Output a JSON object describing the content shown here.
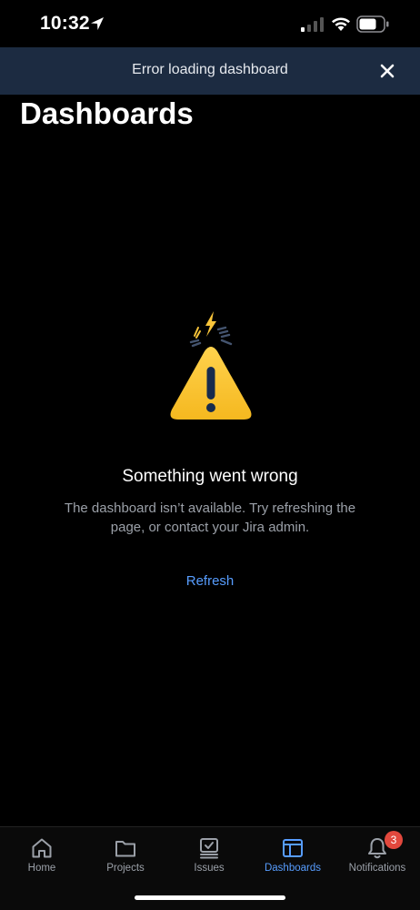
{
  "status_bar": {
    "time": "10:32"
  },
  "banner": {
    "message": "Error loading dashboard",
    "close_icon": "close-icon"
  },
  "header": {
    "title": "Dashboards"
  },
  "error_state": {
    "illustration": "warning-illustration",
    "title": "Something went wrong",
    "description": "The dashboard isn’t available. Try refreshing the page, or contact your Jira admin.",
    "action_label": "Refresh"
  },
  "tab_bar": {
    "tabs": [
      {
        "label": "Home",
        "icon": "home-icon",
        "active": false
      },
      {
        "label": "Projects",
        "icon": "folder-icon",
        "active": false
      },
      {
        "label": "Issues",
        "icon": "issues-icon",
        "active": false
      },
      {
        "label": "Dashboards",
        "icon": "dashboard-icon",
        "active": true
      },
      {
        "label": "Notifications",
        "icon": "bell-icon",
        "active": false,
        "badge": "3"
      }
    ]
  },
  "colors": {
    "background": "#000000",
    "banner": "#1c2b41",
    "accent": "#579dff",
    "badge": "#e2483d",
    "warning": "#f8c43a"
  }
}
